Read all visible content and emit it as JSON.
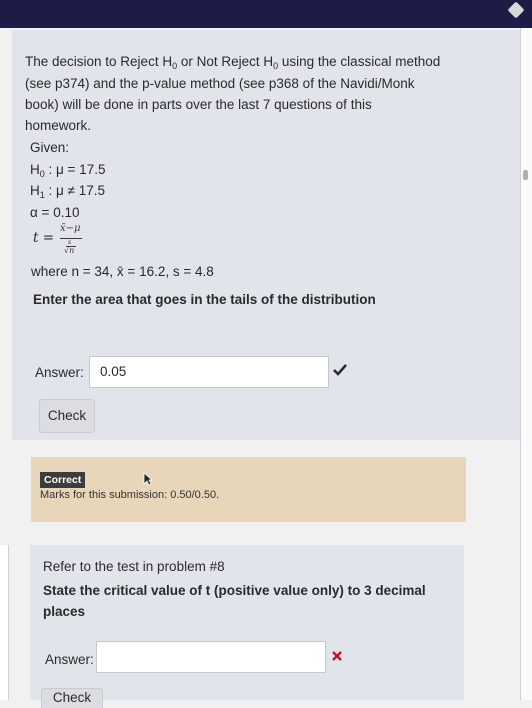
{
  "q1": {
    "line1_a": "The decision to Reject H",
    "line1_b": " or Not Reject H",
    "line1_c": " using the classical method",
    "line2": "(see p374) and the p-value method (see p368 of the Navidi/Monk",
    "line3": "book) will be done in parts over the last 7 questions of this",
    "line4": "homework.",
    "given": "Given:",
    "h0_main": "H",
    "h0_sub": "0",
    "h0_rest": " : μ = 17.5",
    "h1_main": "H",
    "h1_sub": "1",
    "h1_rest": " : μ ≠ 17.5",
    "alpha": "α = 0.10",
    "t_eq": "t =",
    "frac_num": "x̄−μ",
    "frac_den": "√n",
    "frac_inner_num": "s",
    "where": "where n = 34, x̄ = 16.2, s = 4.8",
    "prompt": "Enter the area that goes in the tails of the distribution",
    "answer_label": "Answer:",
    "answer_value": "0.05",
    "check_label": "Check"
  },
  "feedback": {
    "badge": "Correct",
    "marks": "Marks for this submission: 0.50/0.50."
  },
  "q2": {
    "line1": "Refer to the test in problem #8",
    "line2": "State the critical value of t (positive value only) to 3 decimal",
    "line3": "places",
    "answer_label": "Answer:",
    "answer_value": "",
    "check_label": "Check"
  },
  "colors": {
    "topbar": "#1e1b47",
    "panel": "#e2e4ec",
    "feedback": "#e7d6b9",
    "correct_check": "#2a2a2a",
    "wrong_x": "#c8102e"
  }
}
